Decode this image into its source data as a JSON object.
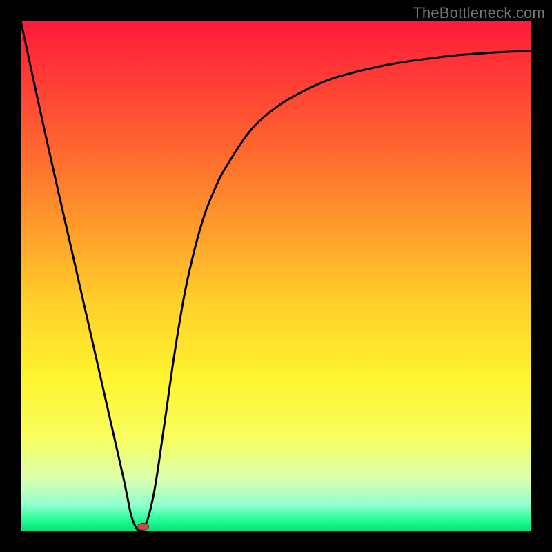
{
  "watermark": "TheBottleneck.com",
  "chart_data": {
    "type": "line",
    "title": "",
    "xlabel": "",
    "ylabel": "",
    "xlim": [
      0,
      100
    ],
    "ylim": [
      0,
      100
    ],
    "grid": false,
    "series": [
      {
        "name": "curve",
        "x": [
          0,
          5,
          10,
          15,
          20,
          22,
          24,
          26,
          28,
          30,
          32,
          34,
          36,
          38,
          40,
          45,
          50,
          55,
          60,
          65,
          70,
          75,
          80,
          85,
          90,
          95,
          100
        ],
        "values": [
          100,
          77,
          55,
          33,
          11,
          2,
          0.5,
          7,
          20,
          34,
          46,
          55,
          62,
          67,
          71,
          78.5,
          83,
          86,
          88.3,
          89.8,
          91,
          91.9,
          92.6,
          93.2,
          93.6,
          93.9,
          94.1
        ]
      }
    ],
    "marker": {
      "x": 24,
      "y": 0.5
    },
    "gradient_stops": [
      {
        "offset": 0.0,
        "color": "#ff1a3a"
      },
      {
        "offset": 0.12,
        "color": "#ff3e35"
      },
      {
        "offset": 0.26,
        "color": "#ff6a2e"
      },
      {
        "offset": 0.4,
        "color": "#ff9a2a"
      },
      {
        "offset": 0.55,
        "color": "#ffcf2a"
      },
      {
        "offset": 0.7,
        "color": "#fff42f"
      },
      {
        "offset": 0.82,
        "color": "#f8ff60"
      },
      {
        "offset": 0.9,
        "color": "#d9ffb0"
      },
      {
        "offset": 0.95,
        "color": "#8cffd0"
      },
      {
        "offset": 0.975,
        "color": "#2aff9a"
      },
      {
        "offset": 1.0,
        "color": "#00e07a"
      }
    ]
  }
}
